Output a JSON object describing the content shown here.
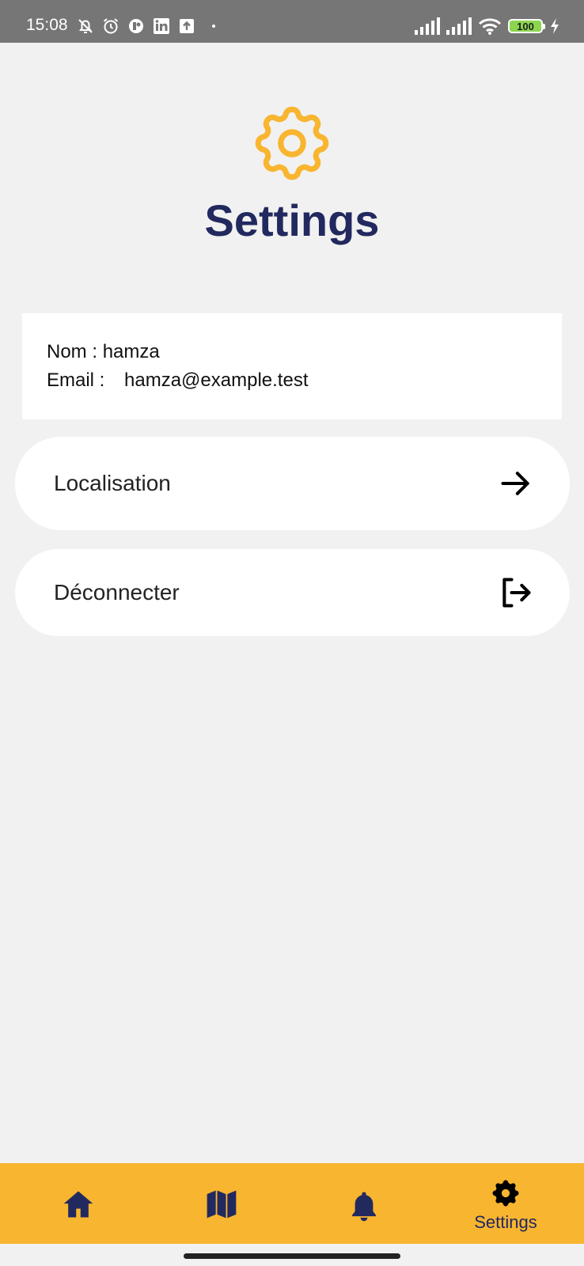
{
  "status_bar": {
    "time": "15:08",
    "battery_level": "100",
    "left_icons": [
      "notifications-off-icon",
      "alarm-icon",
      "app-circle-icon",
      "linkedin-icon",
      "upload-icon",
      "dot-icon"
    ],
    "right_icons": [
      "signal-icon",
      "signal-icon",
      "wifi-icon",
      "battery-icon",
      "charging-icon"
    ]
  },
  "header": {
    "title": "Settings",
    "icon": "gear-icon",
    "icon_color": "#f8b530",
    "title_color": "#22295f"
  },
  "profile": {
    "name_label": "Nom : ",
    "name_value": "hamza",
    "email_label": "Email : ",
    "email_value": "hamza@example.test"
  },
  "menu": {
    "localisation": {
      "label": "Localisation",
      "icon": "arrow-right-icon"
    },
    "logout": {
      "label": "Déconnecter",
      "icon": "logout-icon"
    }
  },
  "bottom_nav": {
    "background_color": "#f8b530",
    "items": [
      {
        "icon": "home-icon",
        "label": ""
      },
      {
        "icon": "map-icon",
        "label": ""
      },
      {
        "icon": "bell-icon",
        "label": ""
      },
      {
        "icon": "gear-icon",
        "label": "Settings",
        "active": true
      }
    ]
  }
}
